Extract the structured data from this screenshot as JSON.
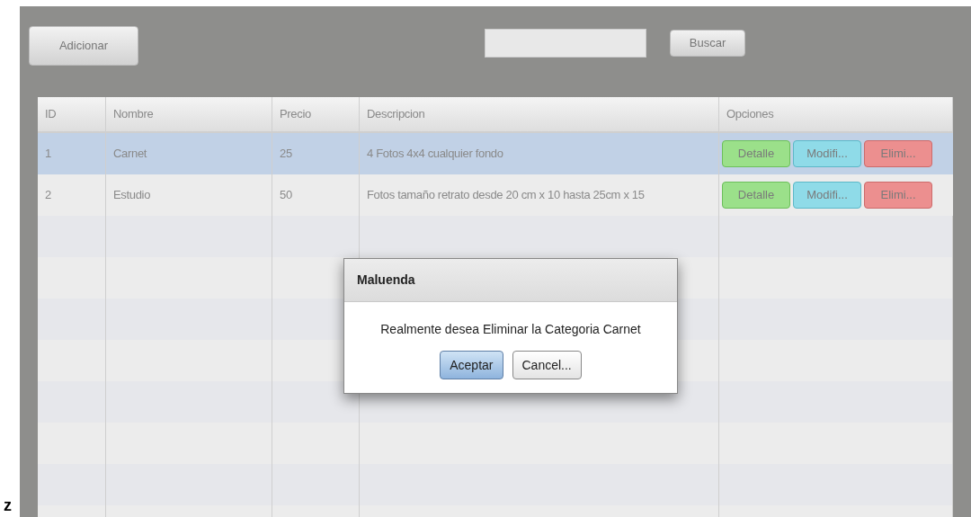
{
  "toolbar": {
    "add_button": "Adicionar",
    "search_button": "Buscar"
  },
  "table": {
    "columns": [
      "ID",
      "Nombre",
      "Precio",
      "Descripcion",
      "Opciones"
    ],
    "rows": [
      {
        "id": "1",
        "name": "Carnet",
        "price": "25",
        "description": "4 Fotos 4x4 cualquier fondo",
        "selected": true,
        "actions": [
          {
            "kind": "detail",
            "label": "Detalle"
          },
          {
            "kind": "modify",
            "label": "Modifi..."
          },
          {
            "kind": "delete",
            "label": "Elimi..."
          }
        ]
      },
      {
        "id": "2",
        "name": "Estudio",
        "price": "50",
        "description": "Fotos tamaño retrato desde 20 cm x 10 hasta 25cm x 15",
        "selected": false,
        "actions": [
          {
            "kind": "detail",
            "label": "Detalle"
          },
          {
            "kind": "modify",
            "label": "Modifi..."
          },
          {
            "kind": "delete",
            "label": "Elimi..."
          }
        ]
      }
    ]
  },
  "dialog": {
    "title": "Maluenda",
    "message": "Realmente desea Eliminar la Categoria Carnet",
    "buttons": [
      {
        "label": "Aceptar",
        "primary": true
      },
      {
        "label": "Cancel...",
        "primary": false
      }
    ]
  },
  "margin_text": "z"
}
